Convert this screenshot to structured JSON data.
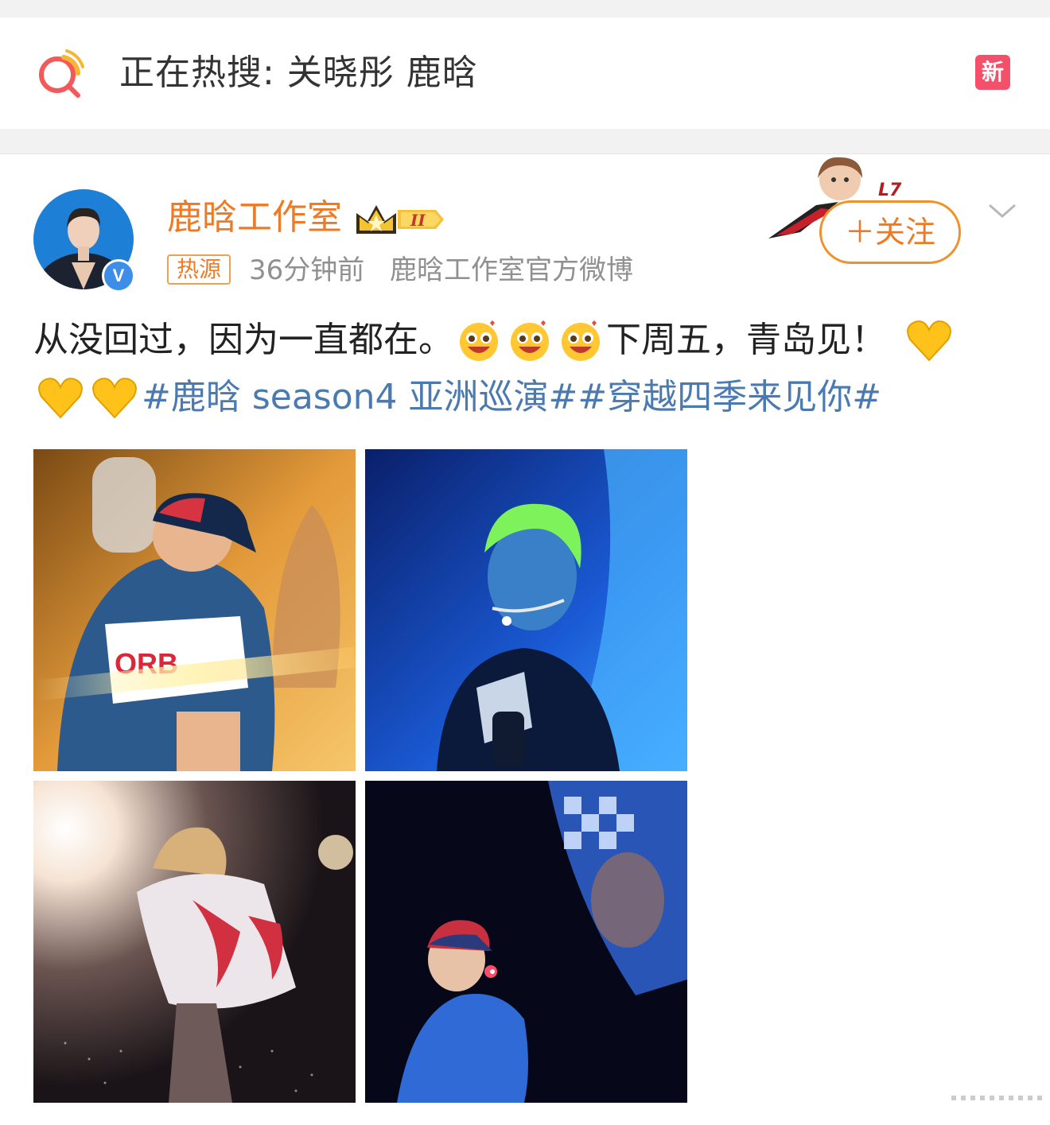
{
  "hot_search": {
    "label": "正在热搜: 关晓彤 鹿晗",
    "badge": "新",
    "icon": "search-trend-icon"
  },
  "post": {
    "author": {
      "name": "鹿晗工作室",
      "member_level": "II",
      "verified_icon": "verified-badge-icon",
      "verified_mark": "V"
    },
    "source_tag": "热源",
    "time": "36分钟前",
    "from": "鹿晗工作室官方微博",
    "follow_label": "＋关注",
    "text": {
      "line1_a": "从没回过，因为一直都在。",
      "line1_b": "下周五，青岛见！",
      "hashtag1": "#鹿晗 season4 亚洲巡演#",
      "hashtag2": "#穿越四季来见你#"
    },
    "emoji": [
      "heart-eyes-emoji",
      "yellow-heart-emoji"
    ],
    "photos": [
      {
        "name": "concert-photo-1",
        "shirt_text": "ORB"
      },
      {
        "name": "concert-photo-2"
      },
      {
        "name": "concert-photo-3"
      },
      {
        "name": "concert-photo-4"
      }
    ]
  },
  "colors": {
    "accent_orange": "#f07a24",
    "hashtag_blue": "#4a7ab0",
    "new_badge": "#f5506a",
    "meta_gray": "#909090",
    "verified_blue": "#3d8ee8"
  }
}
